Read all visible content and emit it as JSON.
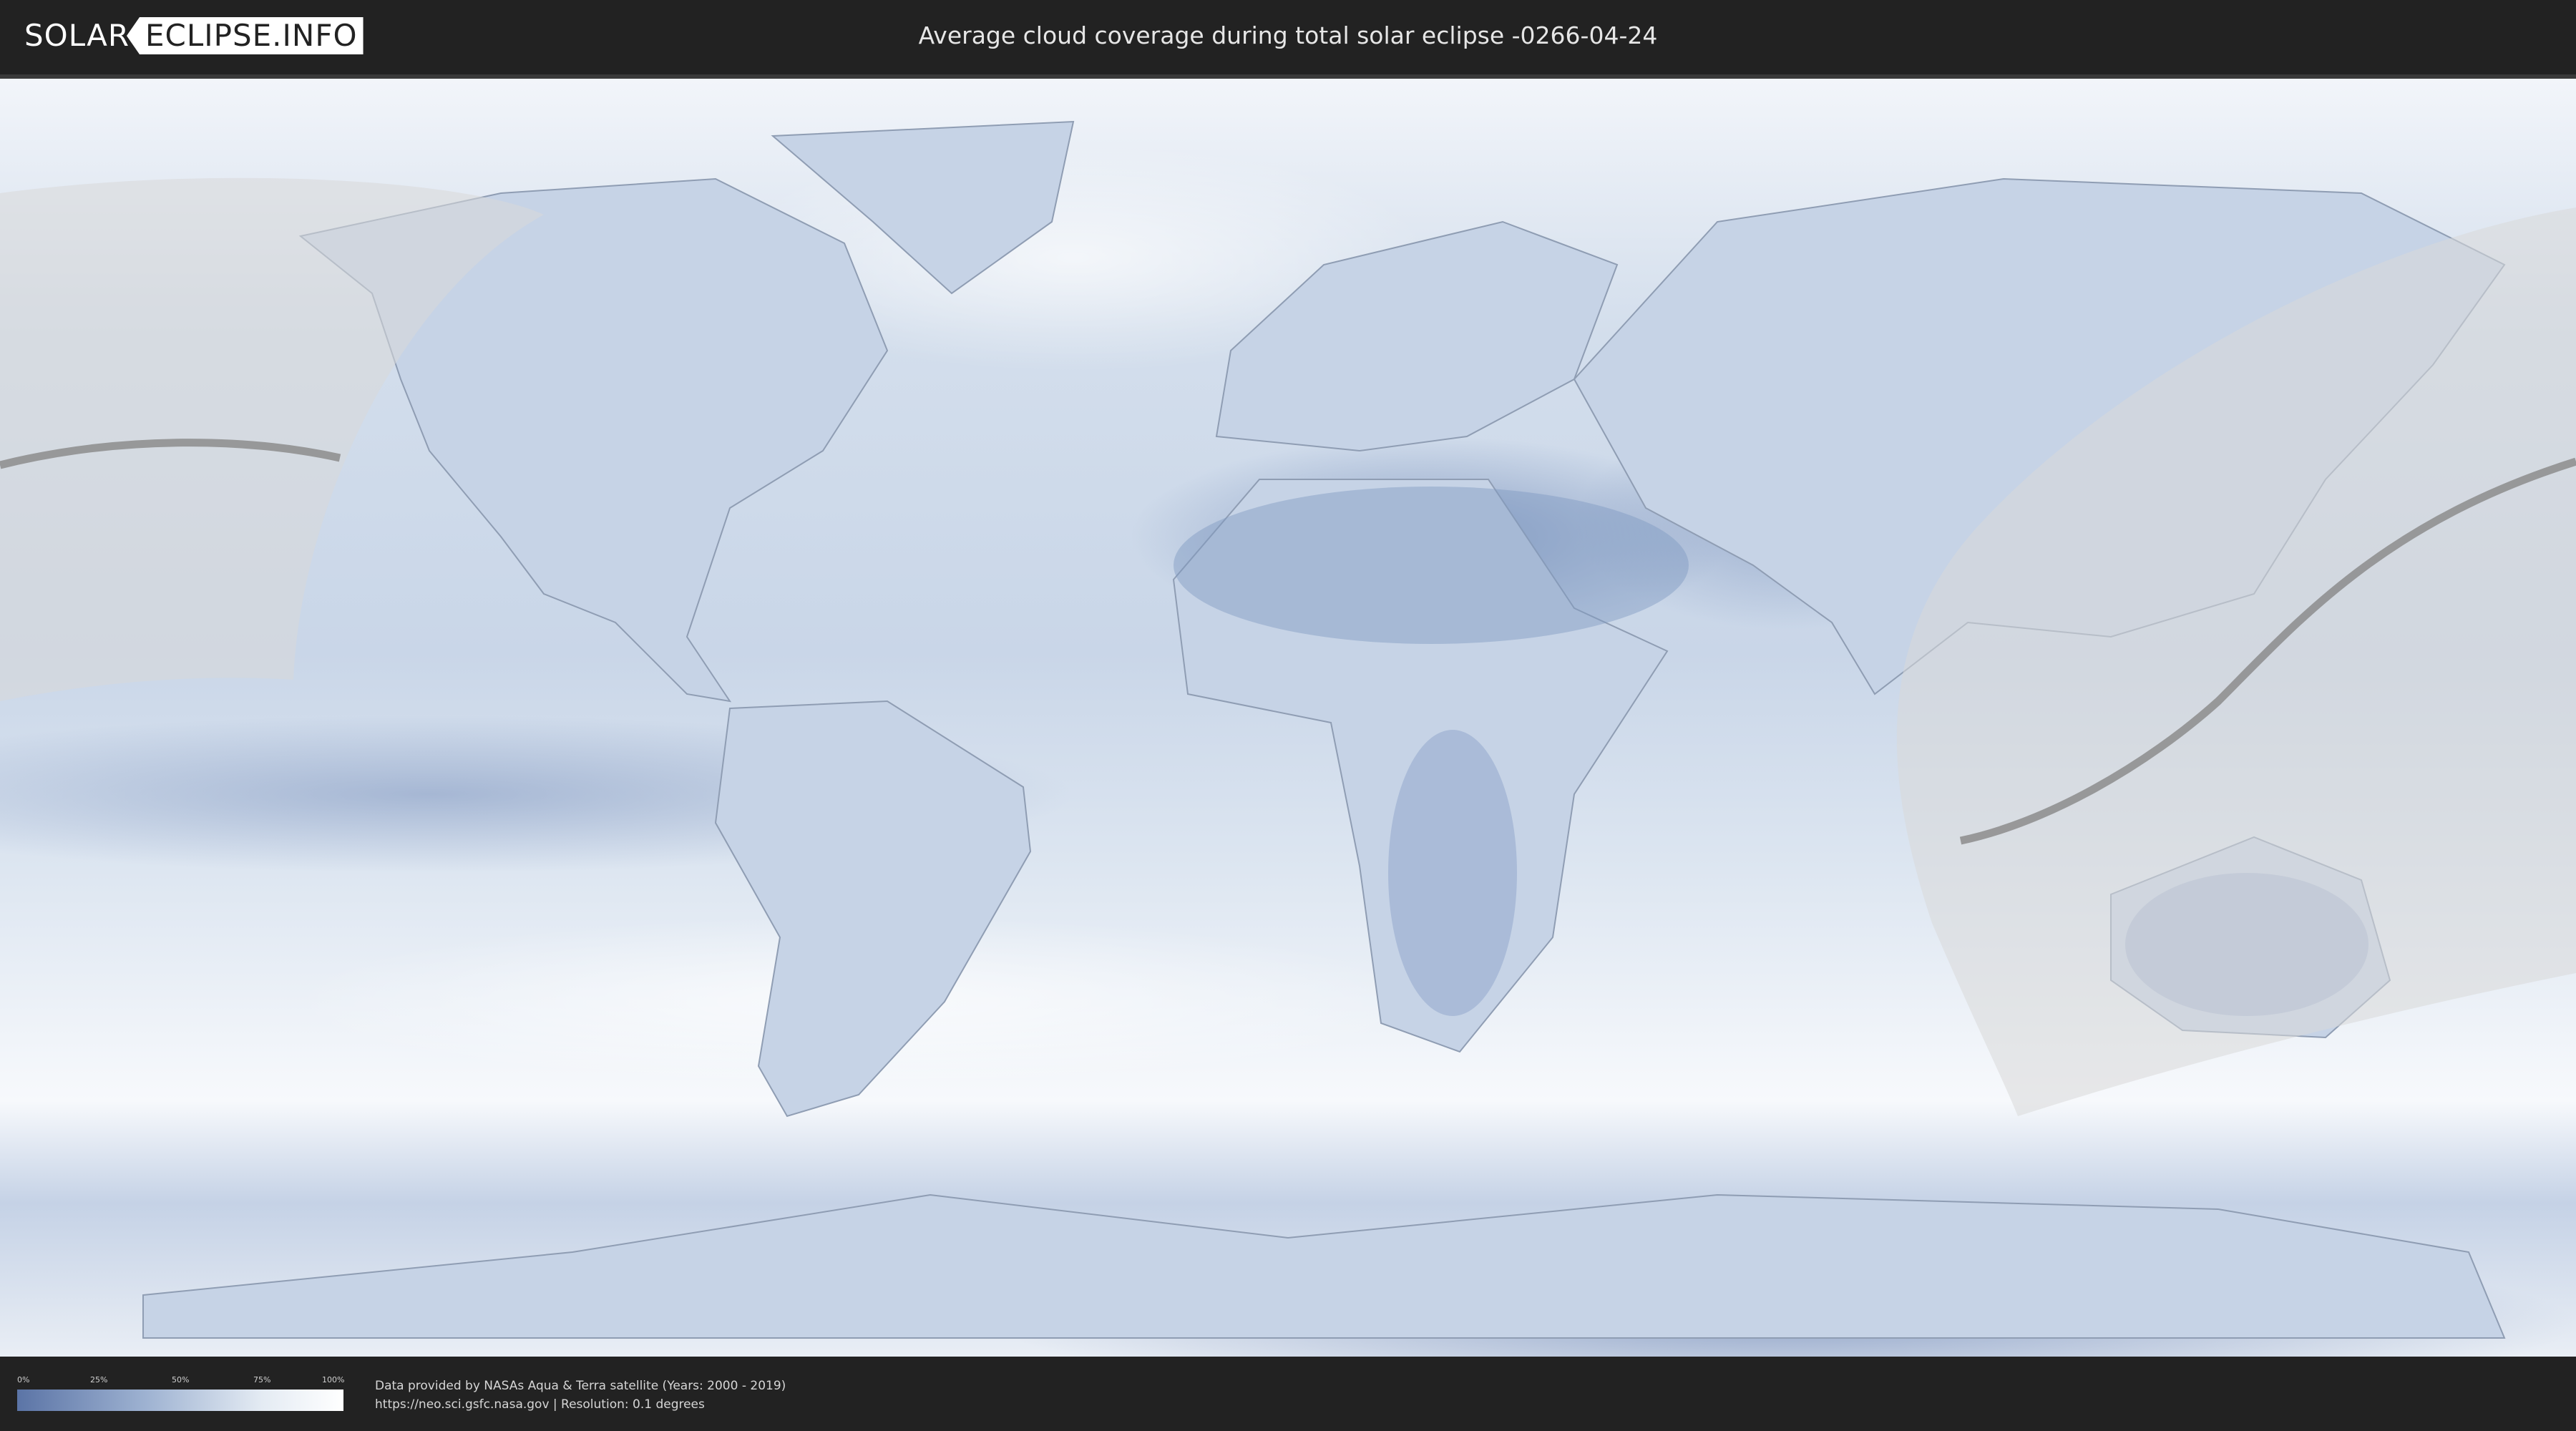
{
  "header": {
    "logo_left": "SOLAR",
    "logo_right": "ECLIPSE.INFO",
    "title": "Average cloud coverage during total solar eclipse -0266-04-24"
  },
  "legend": {
    "ticks": [
      "0%",
      "25%",
      "50%",
      "75%",
      "100%"
    ],
    "color_low": "#5b74a6",
    "color_high": "#ffffff"
  },
  "footer": {
    "source_line": "Data provided by NASAs Aqua & Terra satellite (Years: 2000 - 2019)",
    "url_line": "https://neo.sci.gsfc.nasa.gov | Resolution: 0.1 degrees"
  },
  "map": {
    "projection": "equirectangular",
    "ocean_color": "#e3ebf4",
    "cloud_dense_color": "#ffffff",
    "cloud_sparse_color": "#7f98c2",
    "eclipse_zone_color": "#d8d8d8",
    "eclipse_path_color": "#8c8c8c"
  }
}
